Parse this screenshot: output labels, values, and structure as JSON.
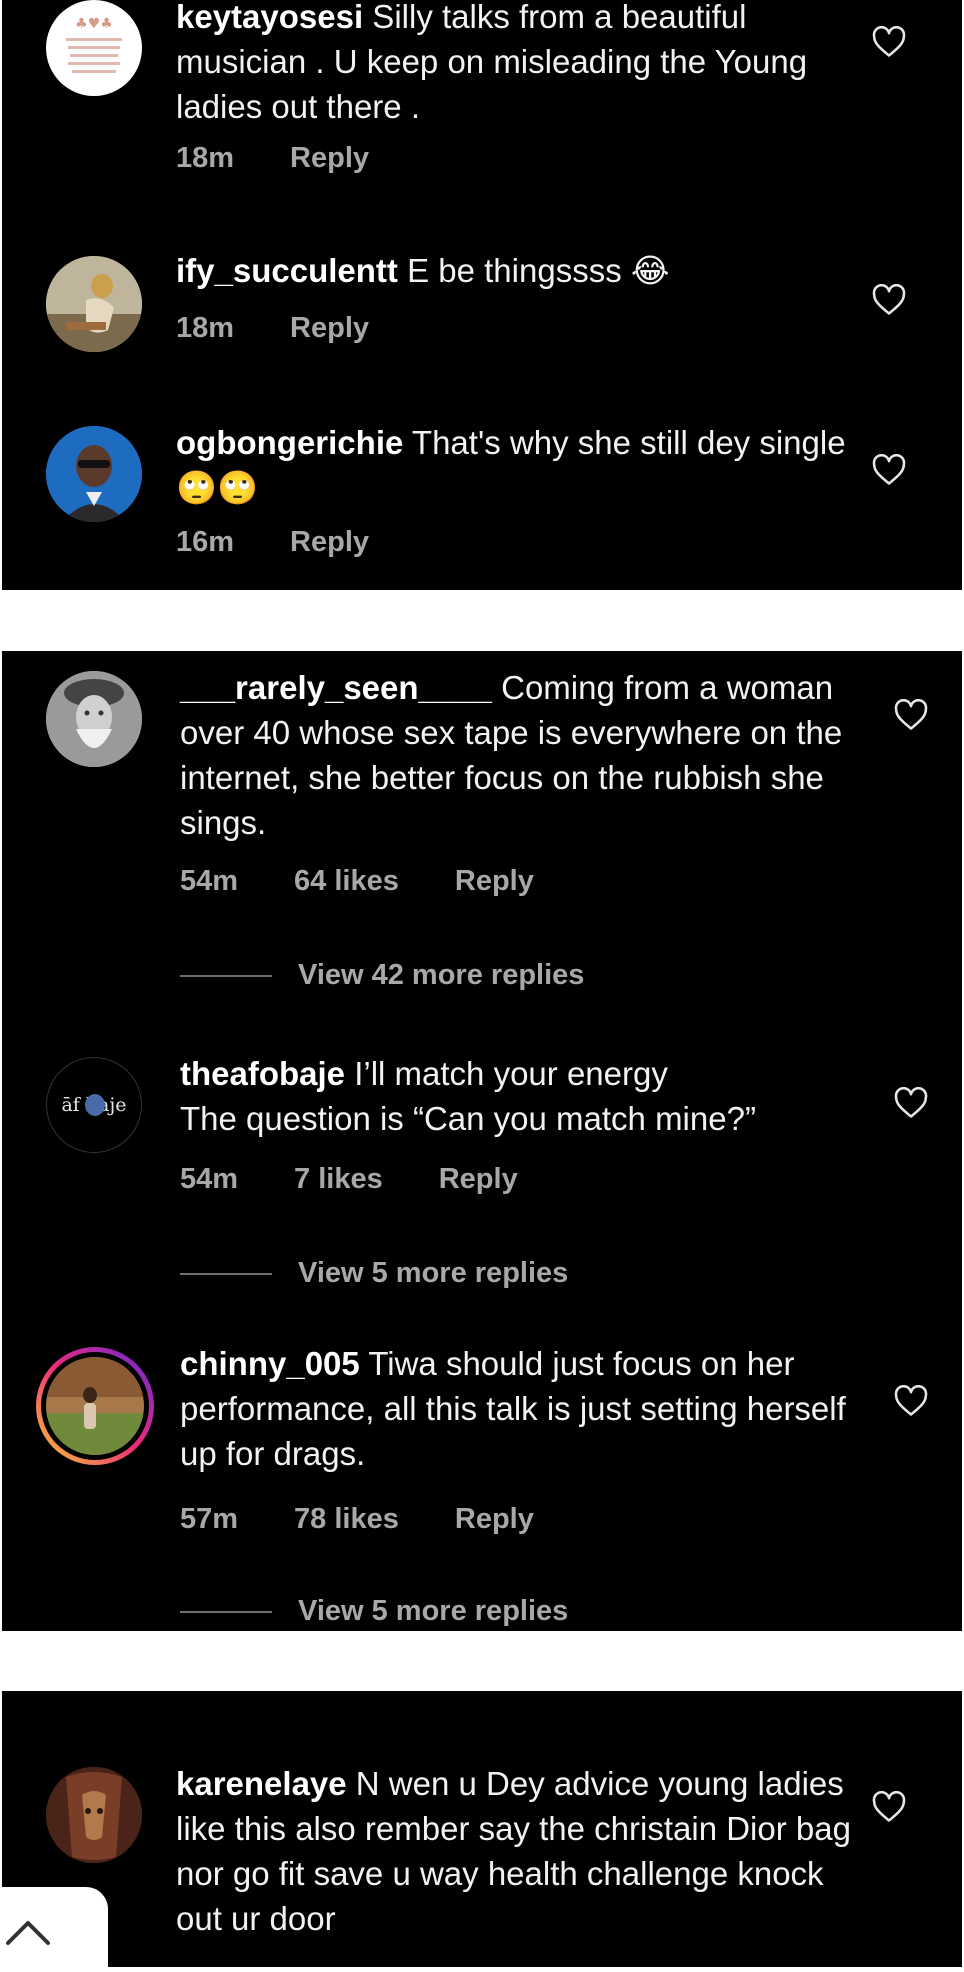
{
  "comments": [
    {
      "username": "keytayosesi",
      "text": " Silly talks from a beautiful musician . U keep on misleading the Young ladies out there .",
      "time": "18m",
      "reply": "Reply"
    },
    {
      "username": "ify_succulentt",
      "text": " E be thingssss 😂",
      "time": "18m",
      "reply": "Reply"
    },
    {
      "username": "ogbongerichie",
      "text": " That's why she still dey single🙄🙄",
      "time": "16m",
      "reply": "Reply"
    },
    {
      "username": "___rarely_seen____",
      "text": " Coming from a woman over 40 whose sex tape is everywhere on the internet, she better focus on the rubbish she sings.",
      "time": "54m",
      "likes": "64 likes",
      "reply": "Reply",
      "view_replies": "View 42 more replies"
    },
    {
      "username": "theafobaje",
      "text": " I’ll match your energy\nThe question is “Can you match mine?”",
      "time": "54m",
      "likes": "7 likes",
      "reply": "Reply",
      "view_replies": "View 5 more replies"
    },
    {
      "username": "chinny_005",
      "text": " Tiwa should just focus on her performance, all this talk is just setting herself up for drags.",
      "time": "57m",
      "likes": "78 likes",
      "reply": "Reply",
      "view_replies": "View 5 more replies"
    },
    {
      "username": "karenelaye",
      "text": " N wen u Dey advice young ladies like this also rember say the christain Dior bag nor go fit save u way health challenge knock out ur door"
    }
  ],
  "avatar_text": {
    "theafobaje": "āf baje"
  },
  "icons": {
    "like": "heart-outline-icon",
    "scroll": "chevron-up-icon"
  },
  "colors": {
    "background": "#000000",
    "text": "#f2f2f2",
    "meta": "#a8a8a8",
    "story_ring": "#d6249f"
  }
}
